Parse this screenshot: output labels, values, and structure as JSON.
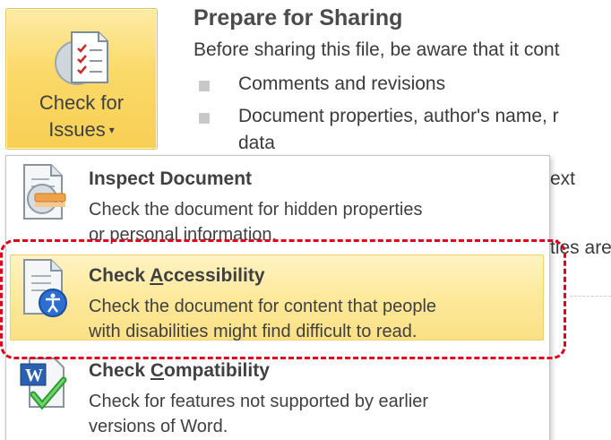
{
  "button": {
    "label_line1": "Check for",
    "label_line2": "Issues",
    "caret": "▾"
  },
  "panel": {
    "title": "Prepare for Sharing",
    "description": "Before sharing this file, be aware that it cont",
    "bullets": [
      "Comments and revisions",
      "Document properties, author's name, r",
      "data"
    ],
    "peek_text_1": "ext",
    "peek_text_2": "ties are"
  },
  "menu": {
    "items": [
      {
        "title": "Inspect Document",
        "desc_line1": "Check the document for hidden properties",
        "desc_line2": "or personal information."
      },
      {
        "title_prefix": "Check ",
        "title_underlined": "A",
        "title_rest": "ccessibility",
        "desc_line1": "Check the document for content that people",
        "desc_line2": "with disabilities might find difficult to read."
      },
      {
        "title_prefix": "Check ",
        "title_underlined": "C",
        "title_rest": "ompatibility",
        "desc_line1": "Check for features not supported by earlier",
        "desc_line2": "versions of Word."
      }
    ]
  },
  "colors": {
    "button_gold": "#f7cf55",
    "highlight": "#fde99c",
    "annotation_red": "#e0001b"
  },
  "icons": [
    "document-check-icon",
    "inspect-document-icon",
    "accessibility-icon",
    "word-compatibility-icon",
    "caret-down-icon"
  ]
}
